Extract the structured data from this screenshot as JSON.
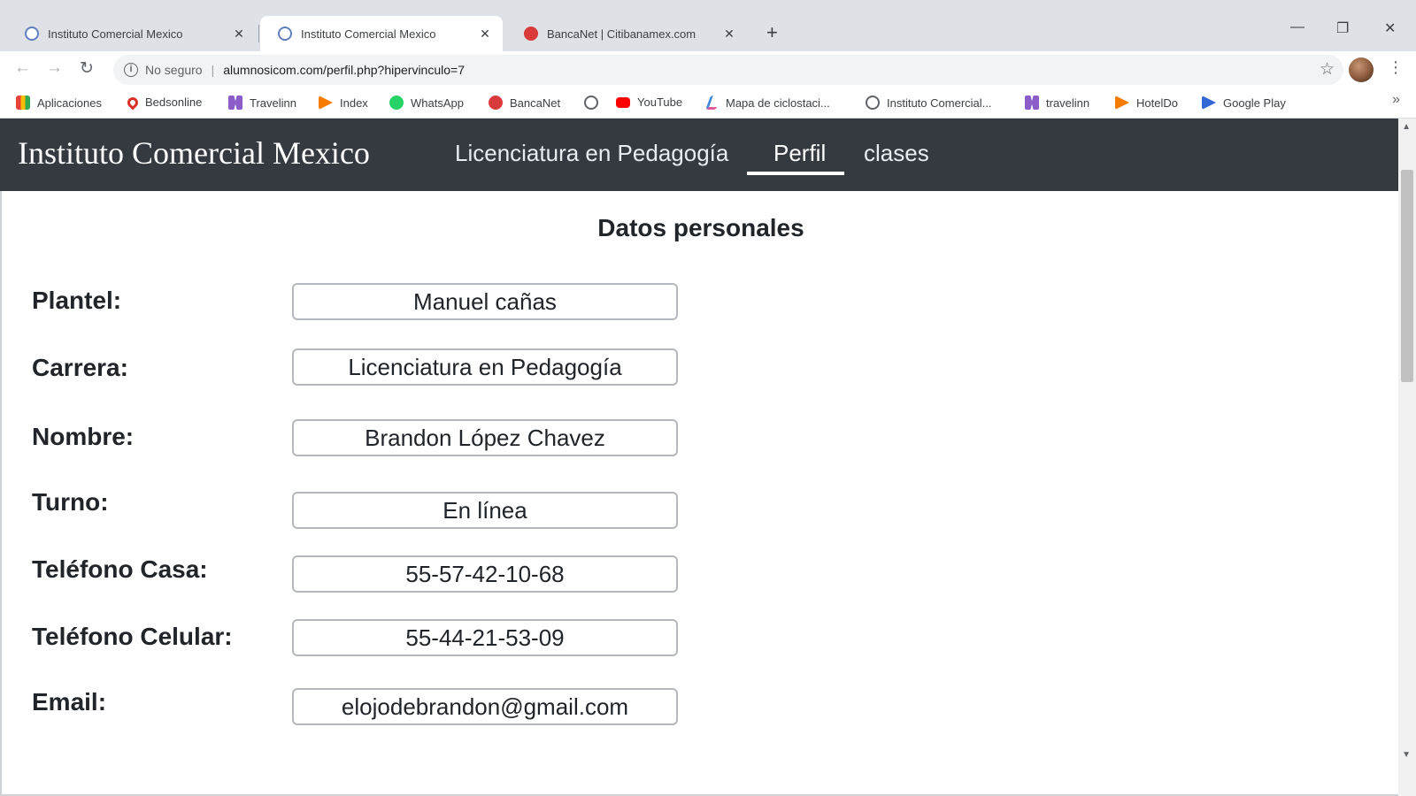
{
  "browser": {
    "tabs": [
      {
        "title": "Instituto Comercial Mexico",
        "active": false
      },
      {
        "title": "Instituto Comercial Mexico",
        "active": true
      },
      {
        "title": "BancaNet | Citibanamex.com",
        "active": false
      }
    ],
    "tab_close_glyph": "✕",
    "new_tab_glyph": "+",
    "window_controls": {
      "minimize": "—",
      "restore": "❐",
      "close": "✕"
    },
    "address_bar": {
      "security_label": "No seguro",
      "separator": "|",
      "url": "alumnosicom.com/perfil.php?hipervinculo=7"
    },
    "bookmarks": [
      {
        "label": "Aplicaciones",
        "icon": "apps-grid-icon"
      },
      {
        "label": "Bedsonline",
        "icon": "pin-icon"
      },
      {
        "label": "Travelinn",
        "icon": "travelinn-icon"
      },
      {
        "label": "Index",
        "icon": "play-arrow-icon"
      },
      {
        "label": "WhatsApp",
        "icon": "whatsapp-icon"
      },
      {
        "label": "BancaNet",
        "icon": "bancanet-icon"
      },
      {
        "label": "",
        "icon": "globe-icon"
      },
      {
        "label": "YouTube",
        "icon": "youtube-icon"
      },
      {
        "label": "Mapa de ciclostaci...",
        "icon": "bike-map-icon"
      },
      {
        "label": "Instituto Comercial...",
        "icon": "globe-icon"
      },
      {
        "label": "travelinn",
        "icon": "travelinn-icon"
      },
      {
        "label": "HotelDo",
        "icon": "play-arrow-icon"
      },
      {
        "label": "Google Play",
        "icon": "google-play-icon"
      }
    ],
    "bookmarks_more": "»"
  },
  "site": {
    "brand": "Instituto Comercial Mexico",
    "nav": [
      {
        "label": "Licenciatura en Pedagogía",
        "active": false
      },
      {
        "label": "Perfil",
        "active": true
      },
      {
        "label": "clases",
        "active": false
      }
    ]
  },
  "profile": {
    "title": "Datos personales",
    "fields": [
      {
        "label": "Plantel:",
        "value": "Manuel cañas"
      },
      {
        "label": "Carrera:",
        "value": "Licenciatura en Pedagogía"
      },
      {
        "label": "Nombre:",
        "value": "Brandon López Chavez"
      },
      {
        "label": "Turno:",
        "value": "En línea"
      },
      {
        "label": "Teléfono Casa:",
        "value": "55-57-42-10-68"
      },
      {
        "label": "Teléfono Celular:",
        "value": "55-44-21-53-09"
      },
      {
        "label": "Email:",
        "value": "elojodebrandon@gmail.com"
      }
    ]
  }
}
